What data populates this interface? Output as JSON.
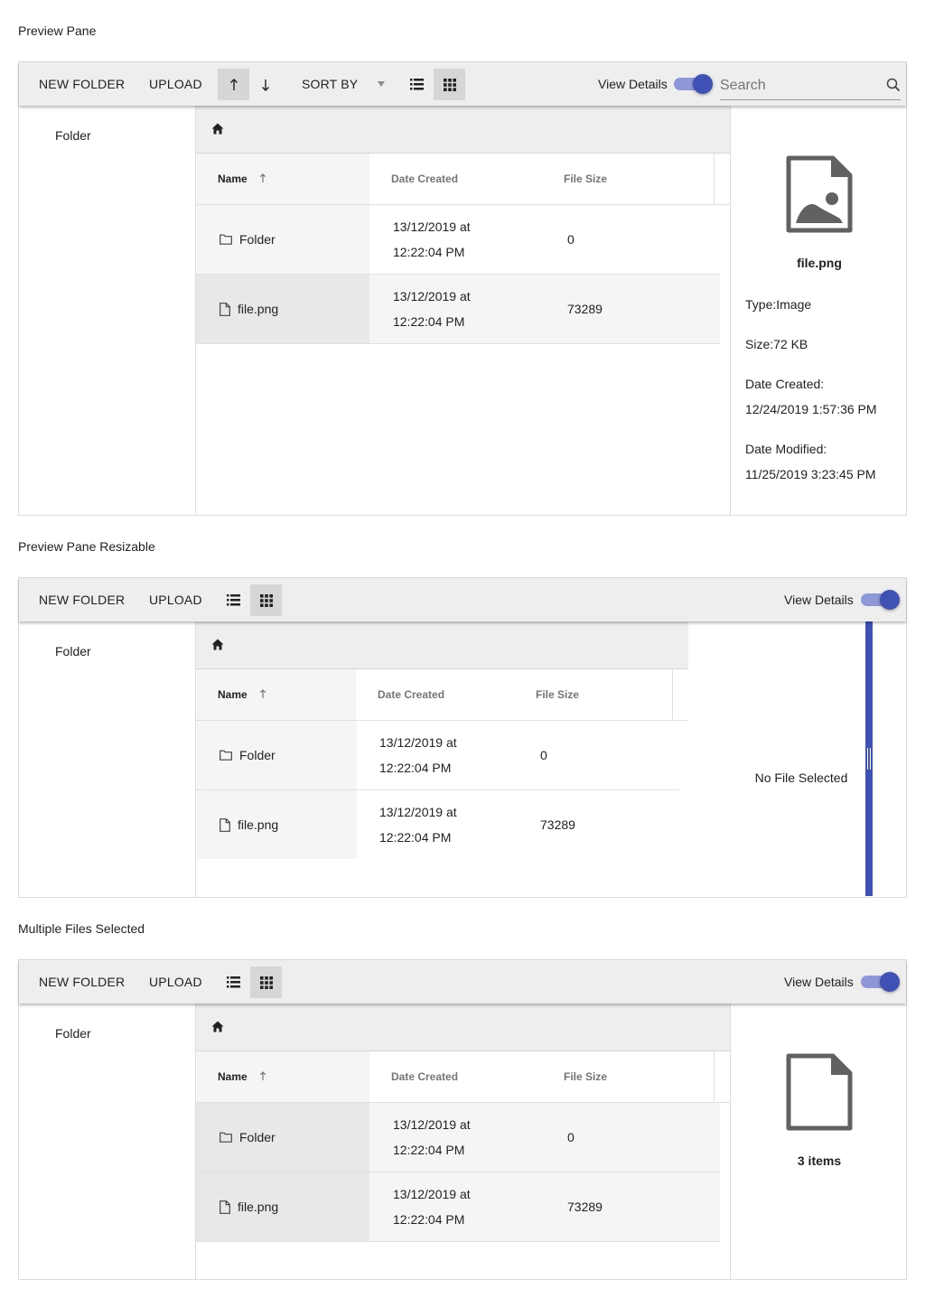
{
  "sections": [
    {
      "title": "Preview Pane",
      "toolbar": {
        "new_folder": "NEW FOLDER",
        "upload": "UPLOAD",
        "sort_by": "SORT BY",
        "view_details": "View Details",
        "search_placeholder": "Search"
      },
      "tree": {
        "root": "Folder"
      },
      "table": {
        "headers": {
          "name": "Name",
          "date": "Date Created",
          "size": "File Size"
        },
        "rows": [
          {
            "name": "Folder",
            "date_line1": "13/12/2019 at",
            "date_line2": "12:22:04 PM",
            "size": "0"
          },
          {
            "name": "file.png",
            "date_line1": "13/12/2019 at",
            "date_line2": "12:22:04 PM",
            "size": "73289"
          }
        ]
      },
      "details": {
        "file_name": "file.png",
        "type": "Type:Image",
        "size": "Size:72 KB",
        "date_created_label": "Date Created:",
        "date_created": "12/24/2019 1:57:36 PM",
        "date_modified_label": "Date Modified:",
        "date_modified": "11/25/2019 3:23:45 PM"
      }
    },
    {
      "title": "Preview Pane Resizable",
      "toolbar": {
        "new_folder": "NEW FOLDER",
        "upload": "UPLOAD",
        "view_details": "View Details"
      },
      "tree": {
        "root": "Folder"
      },
      "table": {
        "headers": {
          "name": "Name",
          "date": "Date Created",
          "size": "File Size"
        },
        "rows": [
          {
            "name": "Folder",
            "date_line1": "13/12/2019 at",
            "date_line2": "12:22:04 PM",
            "size": "0"
          },
          {
            "name": "file.png",
            "date_line1": "13/12/2019 at",
            "date_line2": "12:22:04 PM",
            "size": "73289"
          }
        ]
      },
      "details": {
        "empty_text": "No File Selected"
      }
    },
    {
      "title": "Multiple Files Selected",
      "toolbar": {
        "new_folder": "NEW FOLDER",
        "upload": "UPLOAD",
        "view_details": "View Details"
      },
      "tree": {
        "root": "Folder"
      },
      "table": {
        "headers": {
          "name": "Name",
          "date": "Date Created",
          "size": "File Size"
        },
        "rows": [
          {
            "name": "Folder",
            "date_line1": "13/12/2019 at",
            "date_line2": "12:22:04 PM",
            "size": "0"
          },
          {
            "name": "file.png",
            "date_line1": "13/12/2019 at",
            "date_line2": "12:22:04 PM",
            "size": "73289"
          }
        ]
      },
      "details": {
        "count_text": "3 items"
      }
    }
  ],
  "icons": {
    "home": "home-icon",
    "folder": "folder-icon",
    "file": "file-icon",
    "image_file": "image-file-icon",
    "search": "search-icon",
    "sort_asc": "arrow-up-icon",
    "sort_desc": "arrow-down-icon",
    "list_view": "list-view-icon",
    "grid_view": "grid-view-icon"
  },
  "colors": {
    "accent": "#3f51b5",
    "accent_track": "#8e98d8",
    "toolbar_bg": "#eeeeee",
    "selected_row": "#e8e8e8"
  },
  "state": {
    "view_details_enabled": true,
    "active_view": "grid",
    "sort_direction": "ascending"
  }
}
